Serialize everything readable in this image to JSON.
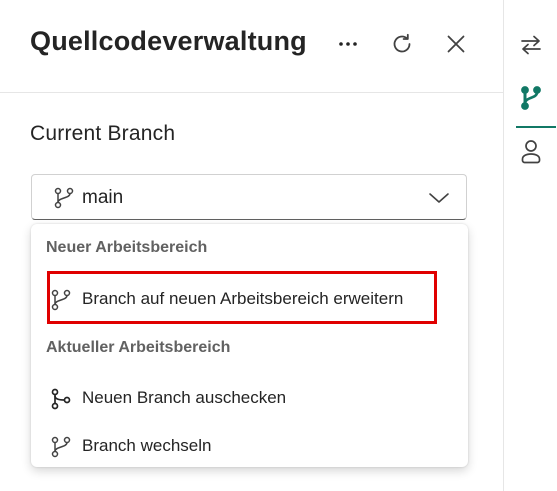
{
  "header": {
    "title": "Quellcodeverwaltung",
    "more_icon": "more-horizontal-icon",
    "refresh_icon": "refresh-icon",
    "close_icon": "close-icon"
  },
  "branch": {
    "section_title": "Current Branch",
    "selected_value": "main",
    "icon": "branch-icon",
    "chevron_icon": "chevron-down-icon"
  },
  "menu": {
    "groups": [
      {
        "label": "Neuer Arbeitsbereich",
        "items": [
          {
            "label": "Branch auf neuen Arbeitsbereich erweitern",
            "icon": "branch-icon"
          }
        ]
      },
      {
        "label": "Aktueller Arbeitsbereich",
        "items": [
          {
            "label": "Neuen Branch auschecken",
            "icon": "branch-fork-icon"
          },
          {
            "label": "Branch wechseln",
            "icon": "branch-icon"
          }
        ]
      }
    ]
  },
  "rail": {
    "items": [
      {
        "icon": "arrow-swap-icon",
        "active": false
      },
      {
        "icon": "branch-icon",
        "active": true
      },
      {
        "icon": "person-icon",
        "active": false
      }
    ]
  },
  "colors": {
    "accent": "#117865",
    "highlight": "#e00000",
    "text": "#242424",
    "muted": "#616161"
  }
}
